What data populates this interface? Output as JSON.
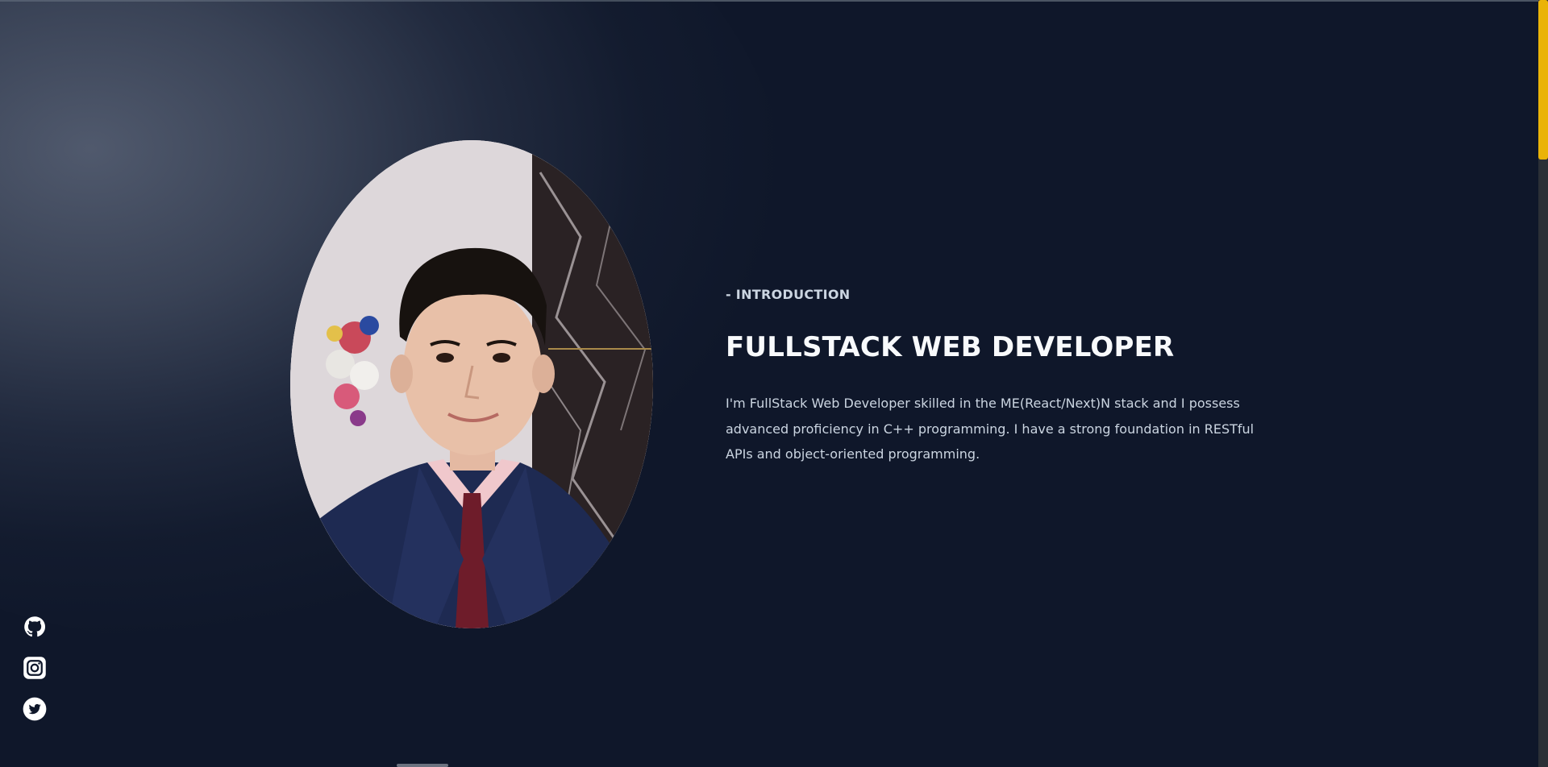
{
  "intro": {
    "eyebrow": "- INTRODUCTION",
    "headline": "FULLSTACK WEB DEVELOPER",
    "description": "I'm FullStack Web Developer skilled in the ME(React/Next)N stack and I possess advanced proficiency in C++ programming. I have a strong foundation in RESTful APIs and object-oriented programming."
  },
  "socials": [
    {
      "icon": "github-icon"
    },
    {
      "icon": "instagram-icon"
    },
    {
      "icon": "twitter-icon"
    }
  ],
  "colors": {
    "background": "#0f172a",
    "scrollbar_thumb": "#eab308",
    "headline": "#f8fafc",
    "body_text": "#cbd5e1"
  }
}
